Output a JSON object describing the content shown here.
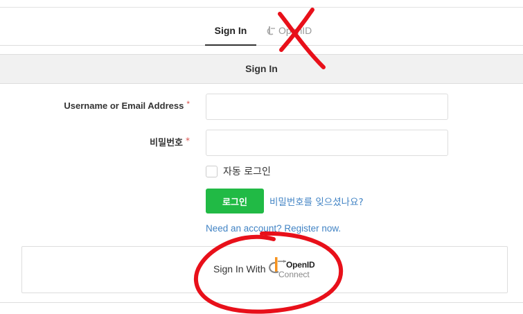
{
  "tabs": [
    {
      "label": "Sign In",
      "active": true
    },
    {
      "label": "OpenID",
      "active": false
    }
  ],
  "form": {
    "header": "Sign In",
    "username_label": "Username or Email Address",
    "password_label": "비밀번호",
    "required_mark": "*",
    "username_value": "",
    "password_value": "",
    "remember_label": "자동 로그인",
    "login_button": "로그인",
    "forgot_link": "비밀번호를 잊으셨나요?",
    "register_link": "Need an account? Register now."
  },
  "openid": {
    "signin_with": "Sign In With",
    "logo_word": "OpenID",
    "logo_connect": "Connect"
  },
  "colors": {
    "accent_green": "#21ba45",
    "link_blue": "#4183c4",
    "required_red": "#d9534f",
    "annotation_red": "#e8101a",
    "openid_orange": "#f7931e"
  },
  "icons": {
    "openid_tab": "openid-logo-icon",
    "openid_button": "openid-connect-logo-icon"
  }
}
